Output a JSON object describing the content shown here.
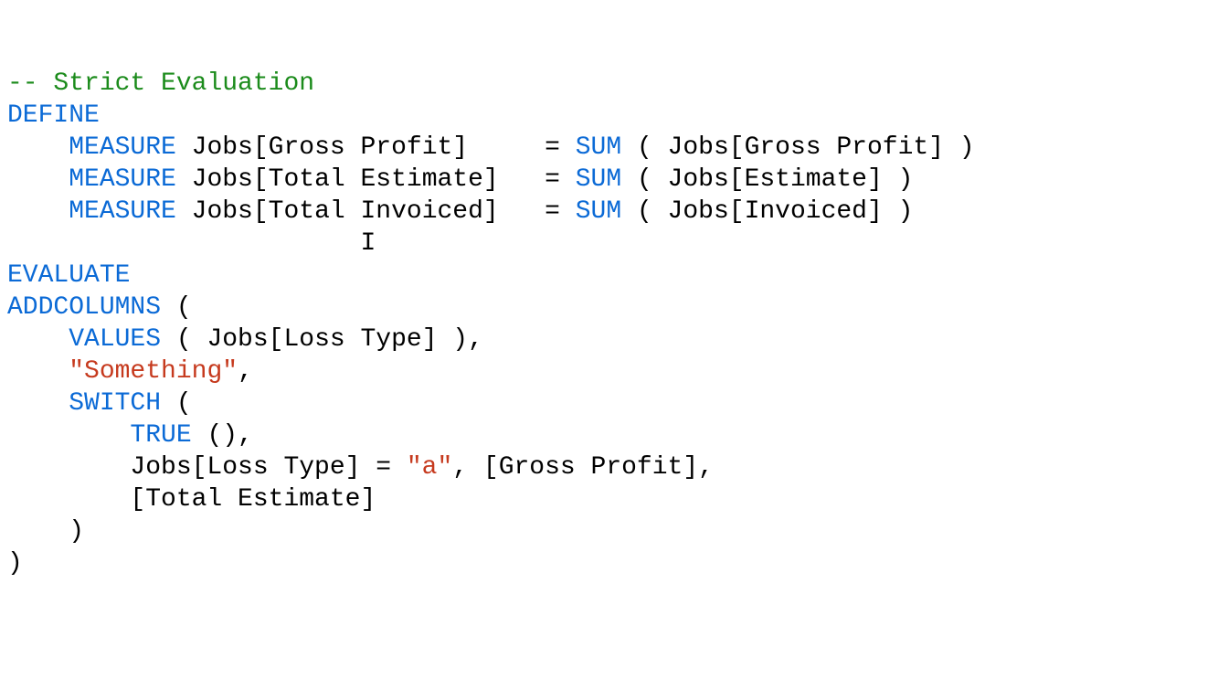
{
  "code": {
    "comment_prefix": "-- ",
    "comment_text": "Strict Evaluation",
    "define_kw": "DEFINE",
    "measure_kw": "MEASURE",
    "measure1_col": " Jobs[Gross Profit]     = ",
    "measure2_col": " Jobs[Total Estimate]   = ",
    "measure3_col": " Jobs[Total Invoiced]   = ",
    "sum_kw": "SUM",
    "measure1_arg": " ( Jobs[Gross Profit] )",
    "measure2_arg": " ( Jobs[Estimate] )",
    "measure3_arg": " ( Jobs[Invoiced] )",
    "evaluate_kw": "EVALUATE",
    "addcolumns_kw": "ADDCOLUMNS",
    "addcolumns_open": " (",
    "values_kw": "VALUES",
    "values_arg": " ( Jobs[Loss Type] ),",
    "something_str": "\"Something\"",
    "something_trail": ",",
    "switch_kw": "SWITCH",
    "switch_open": " (",
    "true_kw": "TRUE",
    "true_trail": " (),",
    "case1_left": "Jobs[Loss Type] = ",
    "case1_str": "\"a\"",
    "case1_right": ", [Gross Profit],",
    "else_ref": "[Total Estimate]",
    "switch_close": ")",
    "addcolumns_close": ")",
    "indent1": "    ",
    "indent2": "        ",
    "cursor_indent": "                       "
  }
}
